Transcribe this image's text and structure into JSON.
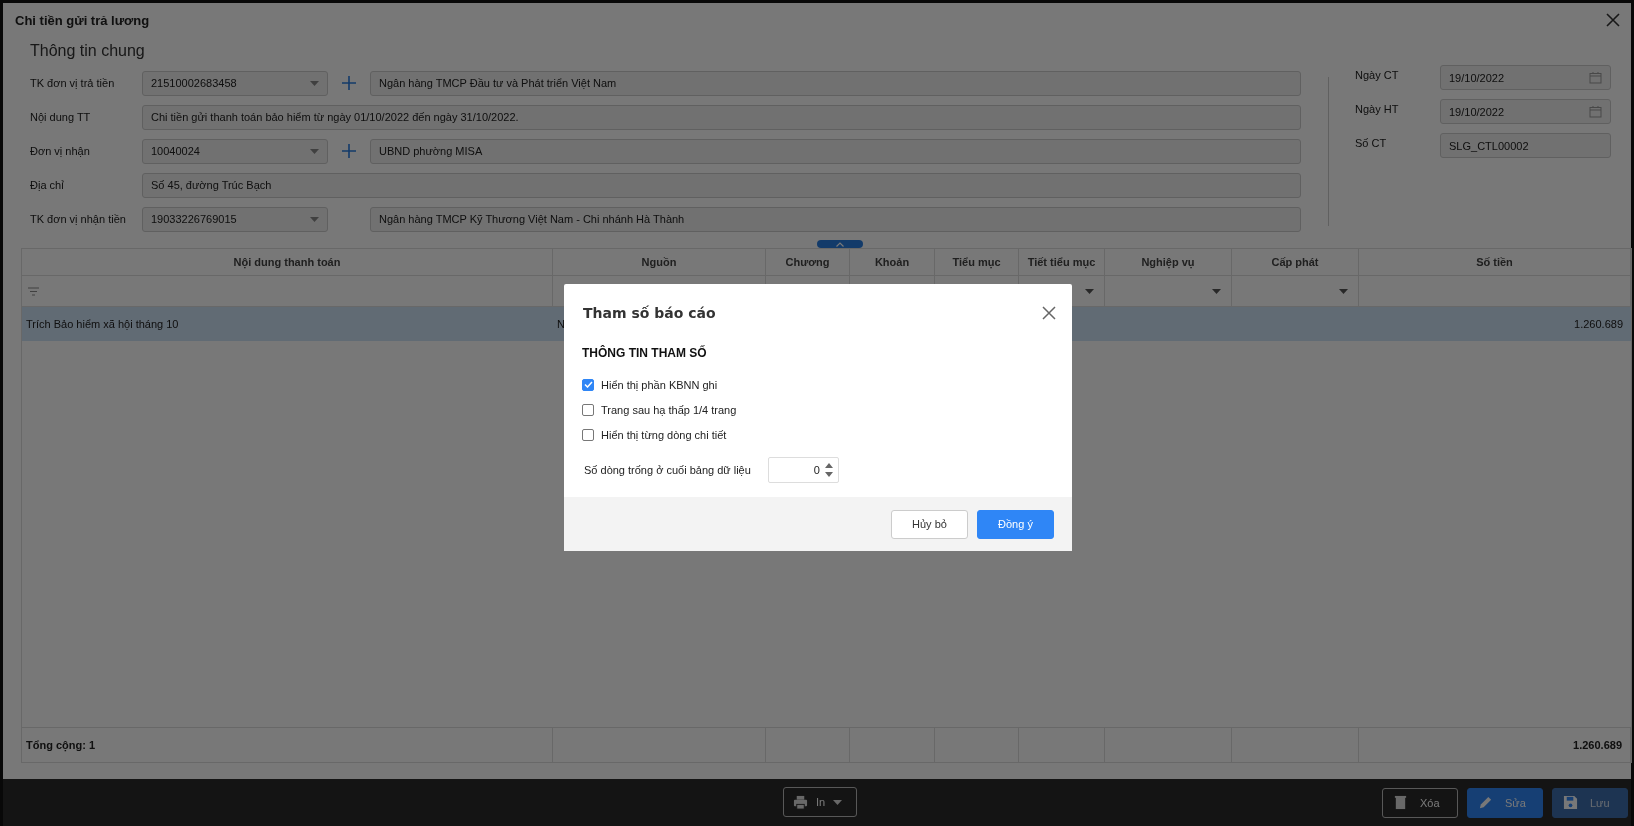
{
  "window": {
    "title": "Chi tiền gửi trả lương"
  },
  "general": {
    "heading": "Thông tin chung",
    "left_fields": [
      {
        "label": "TK đơn vị trả tiền",
        "kind": "combo",
        "value": "21510002683458",
        "add": true,
        "detail": "Ngân hàng TMCP Đầu tư và Phát triển Việt Nam"
      },
      {
        "label": "Nội dung TT",
        "kind": "text",
        "value": "Chi tiền gửi thanh toán bảo hiểm từ ngày 01/10/2022 đến ngày 31/10/2022."
      },
      {
        "label": "Đơn vị nhận",
        "kind": "combo",
        "value": "10040024",
        "add": true,
        "detail": "UBND phường MISA"
      },
      {
        "label": "Địa chỉ",
        "kind": "text",
        "value": "Số 45, đường Trúc Bạch"
      },
      {
        "label": "TK đơn vị nhận tiền",
        "kind": "combo",
        "value": "19033226769015",
        "add": false,
        "detail": "Ngân hàng TMCP Kỹ Thương Việt Nam - Chi nhánh Hà Thành"
      }
    ],
    "right_fields": [
      {
        "label": "Ngày CT",
        "kind": "date",
        "value": "19/10/2022"
      },
      {
        "label": "Ngày HT",
        "kind": "date",
        "value": "19/10/2022"
      },
      {
        "label": "Số CT",
        "kind": "text",
        "value": "SLG_CTL00002"
      }
    ]
  },
  "table": {
    "columns": [
      {
        "label": "Nội dung thanh toán"
      },
      {
        "label": "Nguồn"
      },
      {
        "label": "Chương"
      },
      {
        "label": "Khoản"
      },
      {
        "label": "Tiểu mục"
      },
      {
        "label": "Tiết tiểu mục"
      },
      {
        "label": "Nghiệp vụ"
      },
      {
        "label": "Cấp phát"
      },
      {
        "label": "Số tiền"
      }
    ],
    "rows": [
      {
        "selected": true,
        "cells": [
          "Trích Bảo hiểm xã hội tháng 10",
          "N",
          null,
          null,
          null,
          null,
          null,
          null,
          "1.260.689"
        ]
      }
    ],
    "footer": {
      "label": "Tổng cộng: 1",
      "total": "1.260.689"
    }
  },
  "toolbar": {
    "print": {
      "label": "In"
    },
    "buttons": [
      {
        "label": "Xóa",
        "kind": "outline",
        "disabled": false
      },
      {
        "label": "Sửa",
        "kind": "primary",
        "disabled": false
      },
      {
        "label": "Lưu",
        "kind": "primary",
        "disabled": true
      }
    ]
  },
  "dialog": {
    "title": "Tham số báo cáo",
    "section": "THÔNG TIN THAM SỐ",
    "checkboxes": [
      {
        "label": "Hiển thị phần KBNN ghi",
        "checked": true
      },
      {
        "label": "Trang sau hạ thấp 1/4 trang",
        "checked": false
      },
      {
        "label": "Hiển thị từng dòng chi tiết",
        "checked": false
      }
    ],
    "spinner": {
      "label": "Số dòng trống ở cuối bảng dữ liệu",
      "value": "0"
    },
    "buttons": [
      {
        "label": "Hủy bỏ",
        "kind": "secondary"
      },
      {
        "label": "Đồng ý",
        "kind": "primary"
      }
    ]
  }
}
